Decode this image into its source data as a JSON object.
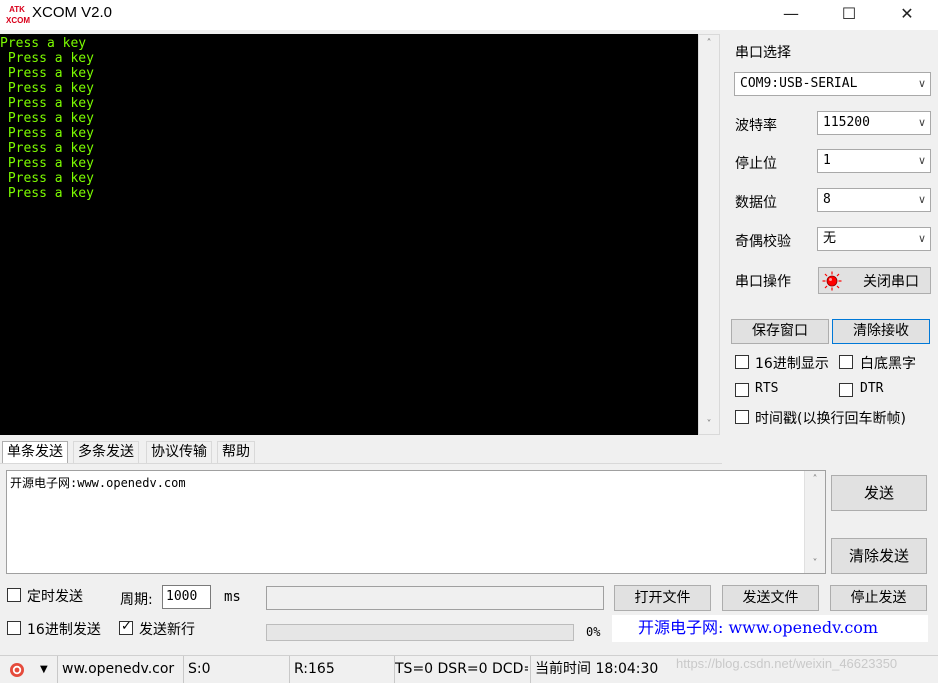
{
  "window": {
    "title": "XCOM V2.0",
    "logo_top": "ATK",
    "logo_bottom": "XCOM",
    "minimize": "—",
    "maximize": "☐",
    "close": "✕"
  },
  "receive": {
    "lines": [
      "Press a key",
      " Press a key",
      " Press a key",
      " Press a key",
      " Press a key",
      " Press a key",
      " Press a key",
      " Press a key",
      " Press a key",
      " Press a key",
      " Press a key"
    ],
    "text_color": "#7CFC00",
    "background": "#000000"
  },
  "serial": {
    "port_label": "串口选择",
    "port_value": "COM9:USB-SERIAL",
    "baud_label": "波特率",
    "baud_value": "115200",
    "stopbits_label": "停止位",
    "stopbits_value": "1",
    "databits_label": "数据位",
    "databits_value": "8",
    "parity_label": "奇偶校验",
    "parity_value": "无",
    "op_label": "串口操作",
    "op_button": "关闭串口",
    "led_color": "#ff0000"
  },
  "recv_controls": {
    "save_window": "保存窗口",
    "clear_recv": "清除接收",
    "hex_display": "16进制显示",
    "white_bg": "白底黑字",
    "rts": "RTS",
    "dtr": "DTR",
    "timestamp": "时间戳(以换行回车断帧)"
  },
  "tabs": [
    "单条发送",
    "多条发送",
    "协议传输",
    "帮助"
  ],
  "send": {
    "text": "开源电子网:www.openedv.com",
    "send_button": "发送",
    "clear_send_button": "清除发送",
    "timed_send": "定时发送",
    "period_label": "周期:",
    "period_value": "1000",
    "period_unit": "ms",
    "hex_send": "16进制发送",
    "send_newline": "发送新行",
    "open_file": "打开文件",
    "send_file": "发送文件",
    "stop_send": "停止发送",
    "progress_text": "0%",
    "progress": 0,
    "promo": "开源电子网: www.openedv.com"
  },
  "status": {
    "url": "ww.openedv.cor",
    "sent": "S:0",
    "received": "R:165",
    "lines": "TS=0 DSR=0 DCD=",
    "time": "当前时间 18:04:30",
    "watermark": "https://blog.csdn.net/weixin_46623350"
  }
}
